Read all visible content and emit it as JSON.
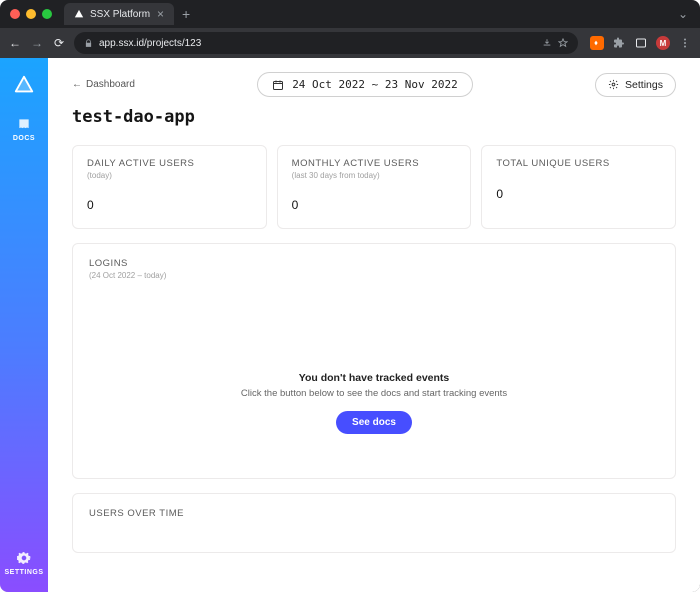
{
  "browser": {
    "tab_title": "SSX Platform",
    "url_display": "app.ssx.id/projects/123",
    "avatar_initial": "M"
  },
  "sidebar": {
    "docs_label": "DOCS",
    "settings_label": "SETTINGS"
  },
  "header": {
    "back_label": "Dashboard",
    "date_range": "24 Oct 2022 ~ 23 Nov 2022",
    "settings_label": "Settings",
    "page_title": "test-dao-app"
  },
  "stats": {
    "dau": {
      "title": "DAILY ACTIVE USERS",
      "sub": "(today)",
      "value": "0"
    },
    "mau": {
      "title": "MONTHLY ACTIVE USERS",
      "sub": "(last 30 days from today)",
      "value": "0"
    },
    "total": {
      "title": "TOTAL UNIQUE USERS",
      "sub": "",
      "value": "0"
    }
  },
  "logins": {
    "title": "LOGINS",
    "sub": "(24 Oct 2022 – today)",
    "empty_title": "You don't have tracked events",
    "empty_sub": "Click the button below to see the docs and start tracking events",
    "button": "See docs"
  },
  "users_over_time": {
    "title": "USERS OVER TIME"
  }
}
